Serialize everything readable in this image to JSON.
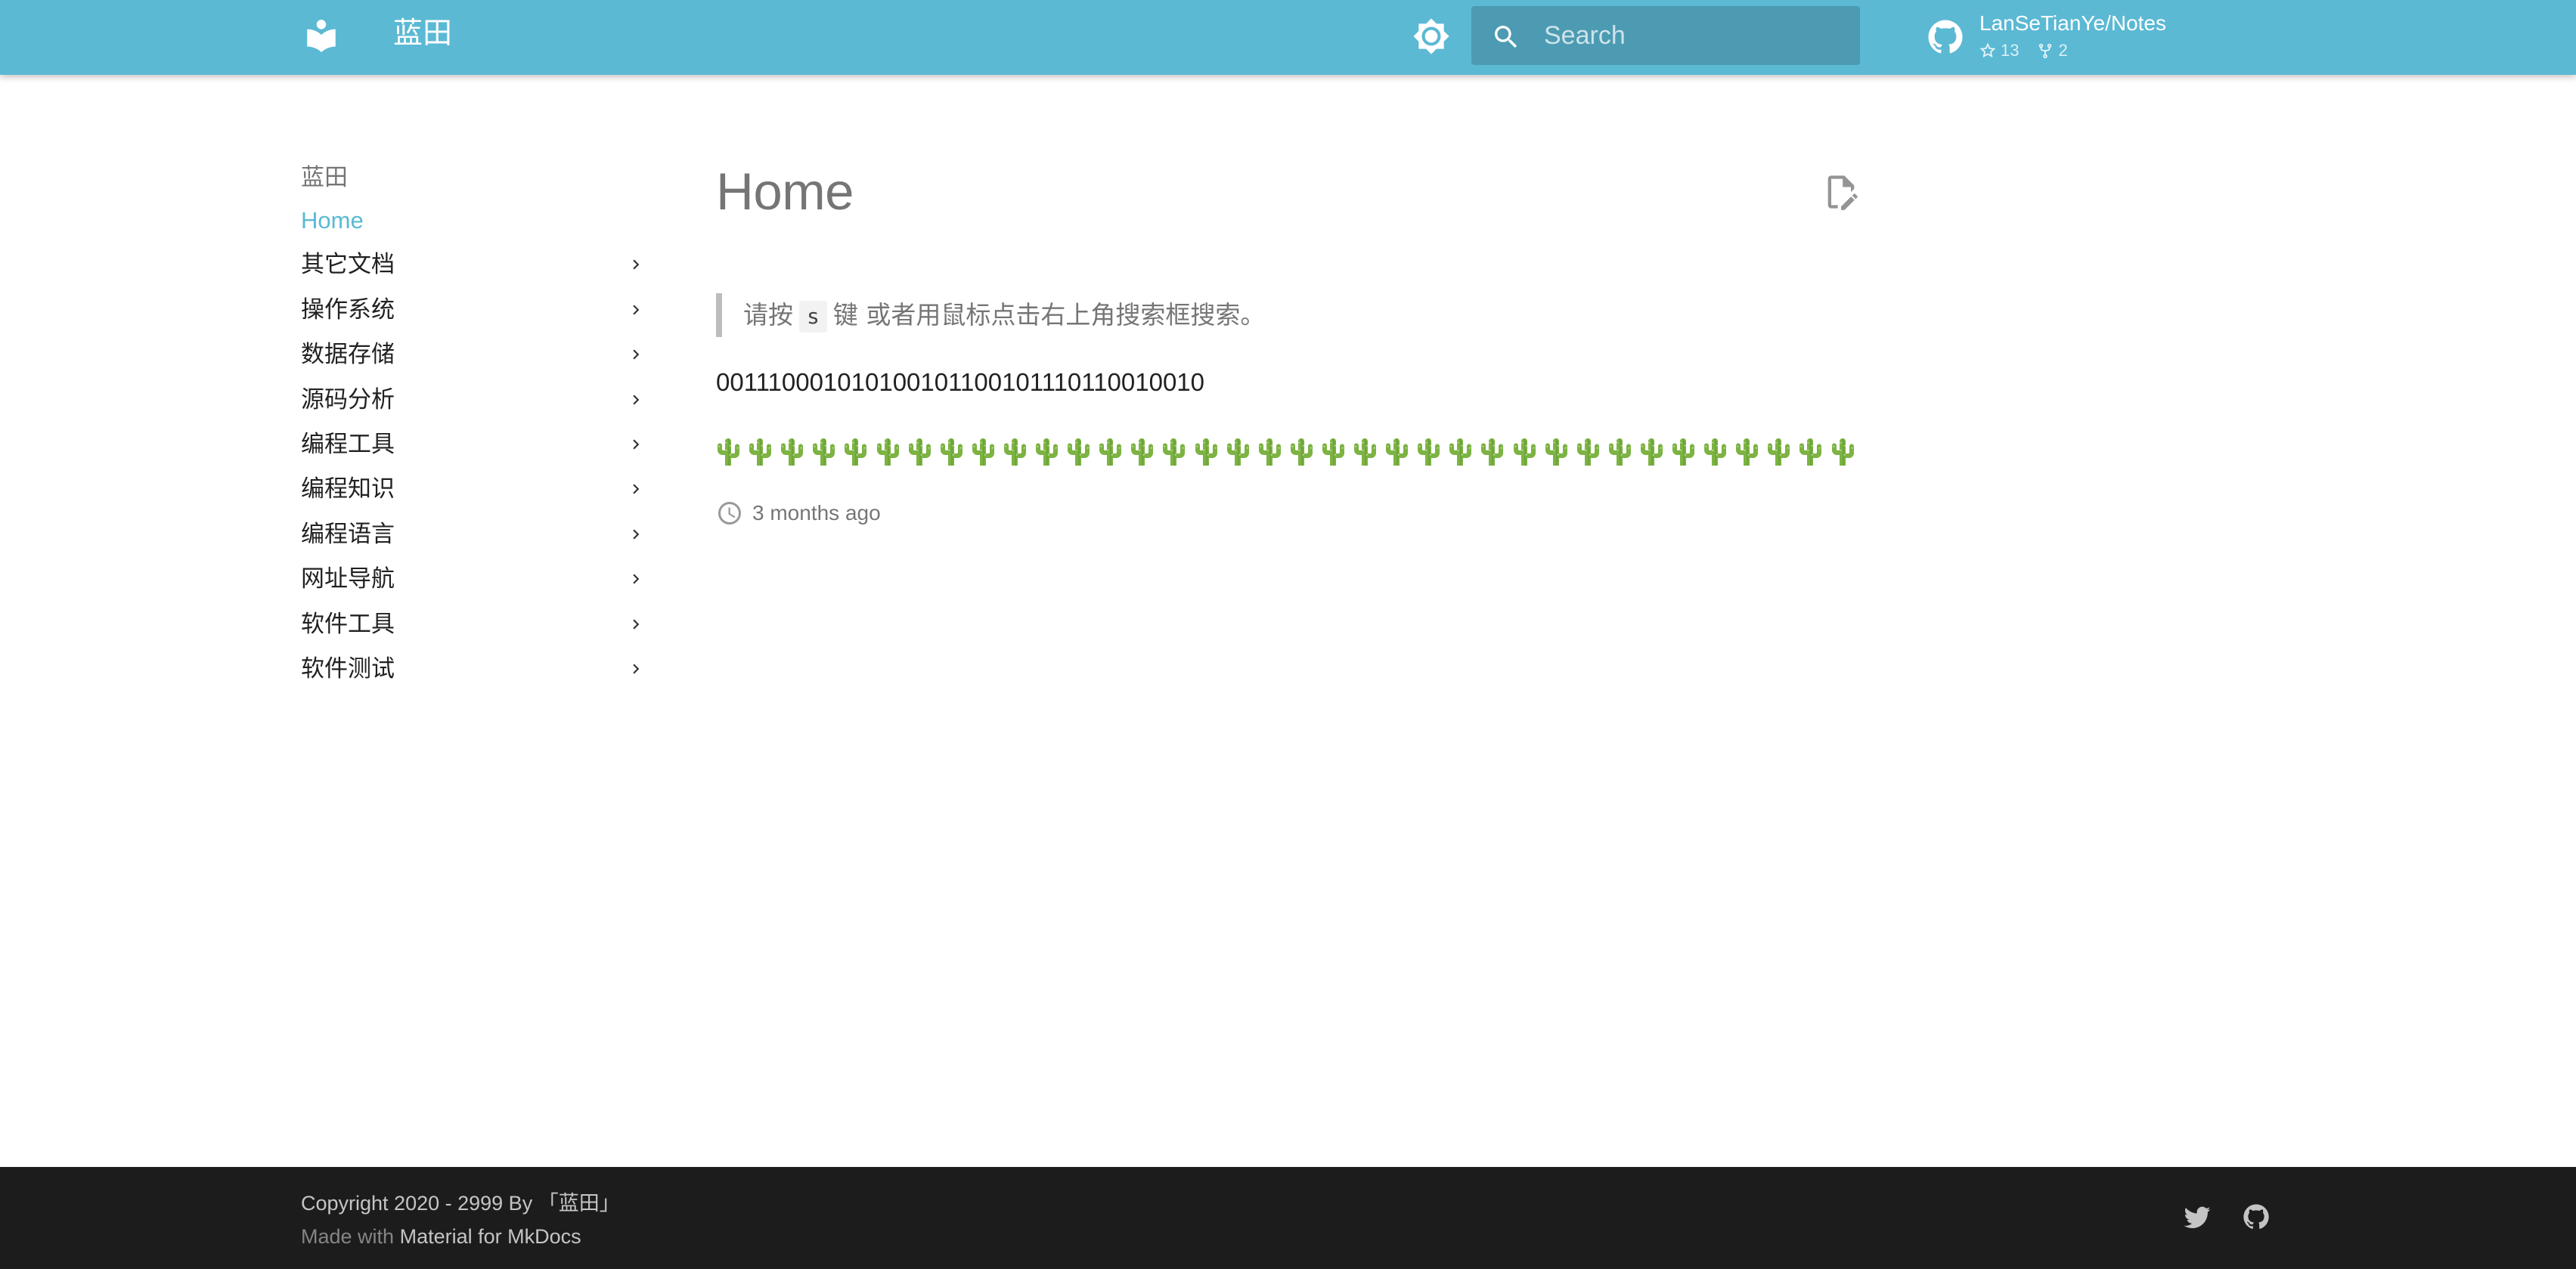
{
  "header": {
    "site_title": "蓝田",
    "search_placeholder": "Search",
    "repo_name": "LanSeTianYe/Notes",
    "repo_stars": "13",
    "repo_forks": "2",
    "accent_color": "#5bb9d4"
  },
  "sidebar": {
    "title": "蓝田",
    "items": [
      {
        "label": "Home",
        "active": true,
        "expandable": false
      },
      {
        "label": "其它文档",
        "active": false,
        "expandable": true
      },
      {
        "label": "操作系统",
        "active": false,
        "expandable": true
      },
      {
        "label": "数据存储",
        "active": false,
        "expandable": true
      },
      {
        "label": "源码分析",
        "active": false,
        "expandable": true
      },
      {
        "label": "编程工具",
        "active": false,
        "expandable": true
      },
      {
        "label": "编程知识",
        "active": false,
        "expandable": true
      },
      {
        "label": "编程语言",
        "active": false,
        "expandable": true
      },
      {
        "label": "网址导航",
        "active": false,
        "expandable": true
      },
      {
        "label": "软件工具",
        "active": false,
        "expandable": true
      },
      {
        "label": "软件测试",
        "active": false,
        "expandable": true
      }
    ]
  },
  "content": {
    "page_title": "Home",
    "quote_before": "请按",
    "quote_key": "s",
    "quote_after": "键 或者用鼠标点击右上角搜索框搜索。",
    "binary": "001110001010100101100101110110010010",
    "cactus_count": 36,
    "revision_date": "3 months ago"
  },
  "footer": {
    "copyright": "Copyright 2020 - 2999 By 「蓝田」",
    "made_with_prefix": "Made with",
    "made_with_link": "Material for MkDocs",
    "background_color": "#1c1c1c"
  },
  "icons": {
    "logo": "book-open-icon",
    "palette": "brightness-icon",
    "search": "magnify-icon",
    "repo": "github-icon",
    "edit": "file-edit-icon",
    "revision": "clock-outline-icon",
    "social": [
      "twitter-icon",
      "github-icon"
    ]
  }
}
